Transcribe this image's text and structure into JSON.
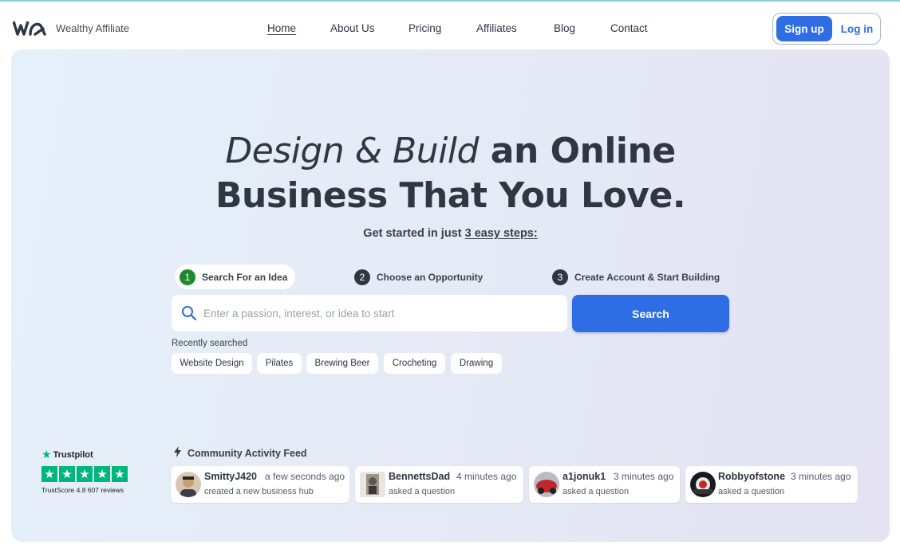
{
  "brand": {
    "name": "Wealthy Affiliate",
    "logo_icon": "wa-logo-icon"
  },
  "nav": {
    "items": [
      {
        "label": "Home",
        "active": true
      },
      {
        "label": "About Us"
      },
      {
        "label": "Pricing"
      },
      {
        "label": "Affiliates"
      },
      {
        "label": "Blog"
      },
      {
        "label": "Contact"
      }
    ],
    "signup_label": "Sign up",
    "login_label": "Log in"
  },
  "hero": {
    "headline_italic": "Design & Build",
    "headline_rest_1": " an Online",
    "headline_line_2": "Business That You Love.",
    "subline_prefix": "Get started in just ",
    "subline_link": "3 easy steps:",
    "steps": [
      {
        "num": "1",
        "label": "Search For an Idea",
        "active": true
      },
      {
        "num": "2",
        "label": "Choose an Opportunity"
      },
      {
        "num": "3",
        "label": "Create Account & Start Building"
      }
    ],
    "search": {
      "placeholder": "Enter a passion, interest, or idea to start",
      "button_label": "Search"
    },
    "recent_label": "Recently searched",
    "recent": [
      "Website Design",
      "Pilates",
      "Brewing Beer",
      "Crocheting",
      "Drawing"
    ]
  },
  "trustpilot": {
    "label": "Trustpilot",
    "score_text": "TrustScore 4.8 607 reviews",
    "stars": 5
  },
  "feed": {
    "title": "Community Activity Feed",
    "items": [
      {
        "user": "SmittyJ420",
        "time": "a few seconds ago",
        "action": "created a new business hub"
      },
      {
        "user": "BennettsDad",
        "time": "4 minutes ago",
        "action": "asked a question"
      },
      {
        "user": "a1jonuk1",
        "time": "3 minutes ago",
        "action": "asked a question"
      },
      {
        "user": "Robbyofstone",
        "time": "3 minutes ago",
        "action": "asked a question"
      }
    ]
  },
  "colors": {
    "accent": "#2f6de5",
    "trustpilot": "#00b67a",
    "step_active": "#1e8a2e"
  }
}
